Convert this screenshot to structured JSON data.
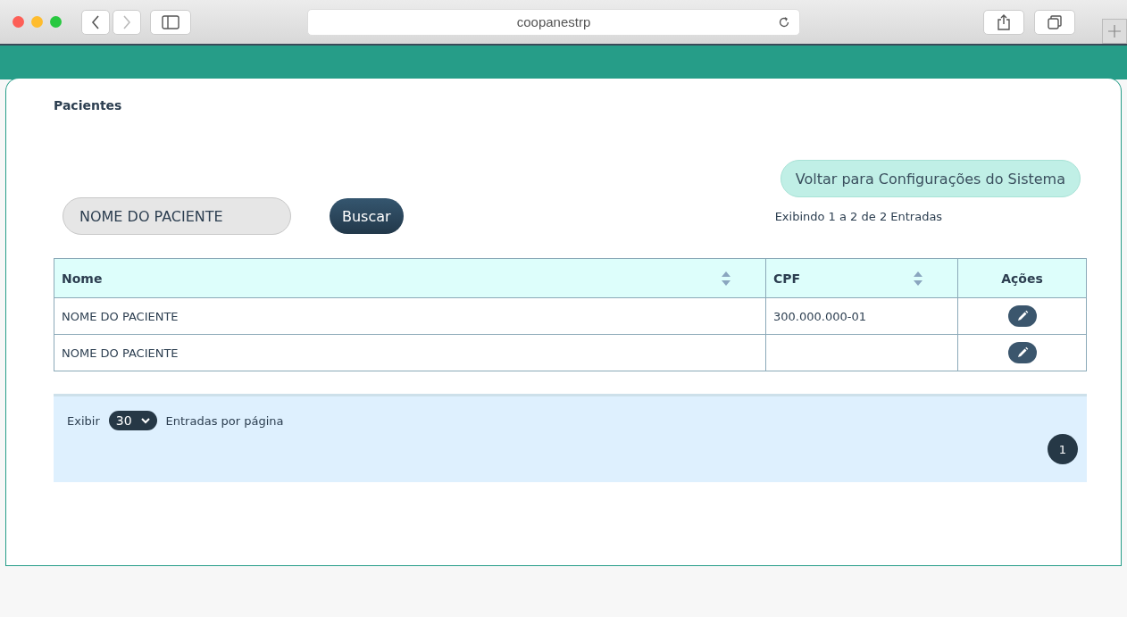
{
  "browser": {
    "url": "coopanestrp"
  },
  "page": {
    "title": "Pacientes"
  },
  "back_button": "Voltar para Configurações do Sistema",
  "search": {
    "value": "NOME DO PACIENTE",
    "button": "Buscar"
  },
  "summary": "Exibindo 1 a 2 de 2 Entradas",
  "table": {
    "columns": [
      {
        "label": "Nome",
        "sortable": true
      },
      {
        "label": "CPF",
        "sortable": true
      },
      {
        "label": "Ações",
        "sortable": false
      }
    ],
    "rows": [
      {
        "name": "NOME DO PACIENTE",
        "cpf": "300.000.000-01"
      },
      {
        "name": "NOME DO PACIENTE",
        "cpf": ""
      }
    ]
  },
  "footer": {
    "show_label": "Exibir",
    "page_size": "30",
    "per_page_label": "Entradas por página",
    "pages": [
      {
        "label": "1",
        "selected": true
      }
    ]
  }
}
